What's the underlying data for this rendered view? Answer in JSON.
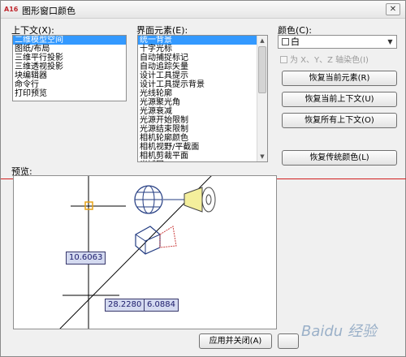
{
  "window": {
    "title": "图形窗口颜色",
    "app_icon": "A16",
    "close": "✕"
  },
  "context": {
    "label": "上下文(X):",
    "items": [
      "二维模型空间",
      "图纸/布局",
      "三维平行投影",
      "三维透视投影",
      "块编辑器",
      "命令行",
      "打印预览"
    ],
    "selected_index": 0
  },
  "elements": {
    "label": "界面元素(E):",
    "items": [
      "统一背景",
      "十字光标",
      "自动捕捉标记",
      "自动追踪矢量",
      "设计工具提示",
      "设计工具提示背景",
      "光线轮廓",
      "光源聚光角",
      "光源衰减",
      "光源开始限制",
      "光源结束限制",
      "相机轮廓颜色",
      "相机视野/平截面",
      "相机剪裁平面",
      "光域网"
    ],
    "selected_index": 0
  },
  "color": {
    "label": "颜色(C):",
    "value": "白",
    "swatch_color": "#ffffff",
    "tint_checkbox": "为 X、Y、Z 轴染色(I)",
    "tint_checked": false
  },
  "buttons": {
    "restore_current_element": "恢复当前元素(R)",
    "restore_current_context": "恢复当前上下文(U)",
    "restore_all_contexts": "恢复所有上下文(O)",
    "restore_classic_colors": "恢复传统颜色(L)",
    "apply_close": "应用并关闭(A)"
  },
  "preview": {
    "label": "预览:",
    "coord_1": "10.6063",
    "coord_2": "28.2280",
    "coord_3": "6.0884"
  },
  "colors": {
    "selection": "#3399ff",
    "accent_line": "#d21f1f",
    "grip": "#e8a317"
  },
  "watermark": "Baidu 经验"
}
